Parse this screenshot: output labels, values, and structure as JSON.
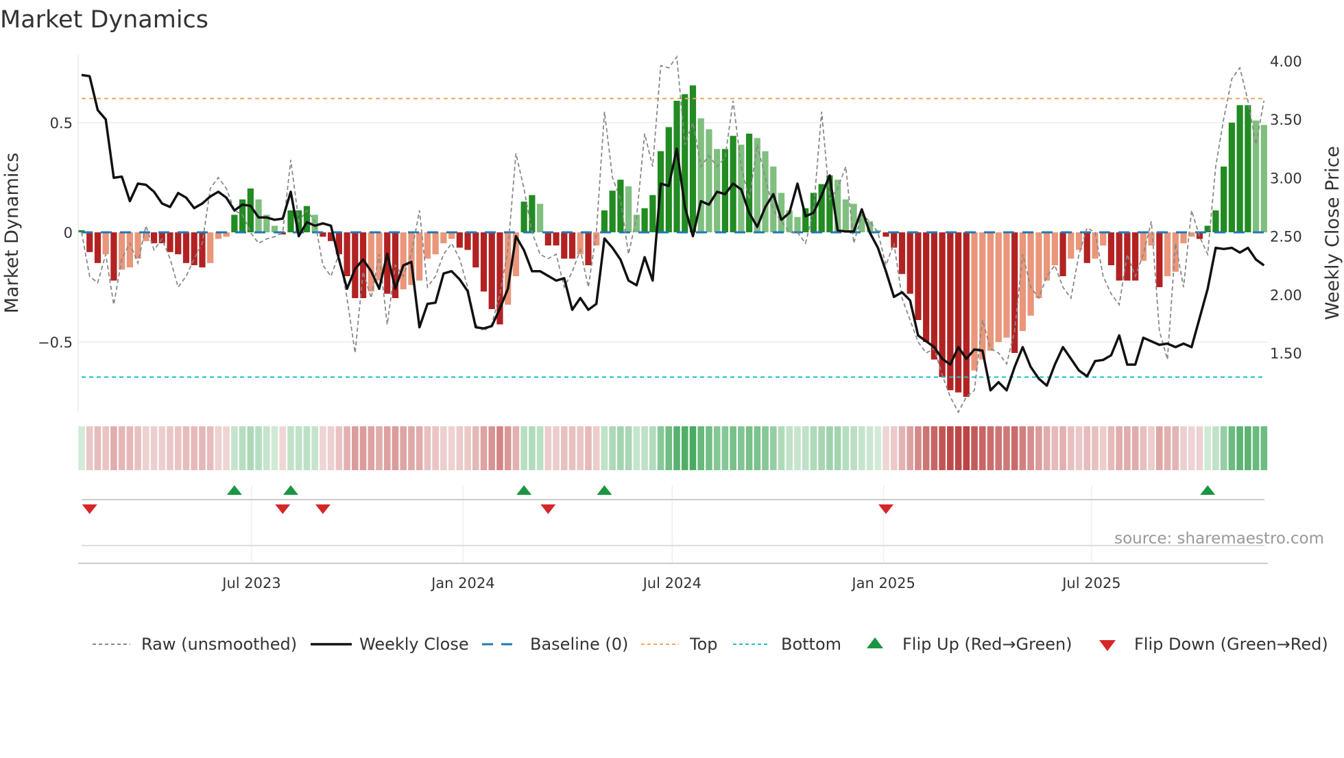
{
  "chart_data": {
    "type": "bar",
    "title": "Market Dynamics",
    "ylabel_left": "Market Dynamics",
    "ylabel_right": "Weekly Close Price",
    "frequency": "weekly",
    "start_date": "2023-02-03",
    "yticks_left": [
      {
        "value": 0.5,
        "label": "0.5"
      },
      {
        "value": 0,
        "label": "0"
      },
      {
        "value": -0.5,
        "label": "−0.5"
      }
    ],
    "yticks_right": [
      {
        "value": 4.0,
        "label": "4.00"
      },
      {
        "value": 3.5,
        "label": "3.50"
      },
      {
        "value": 3.0,
        "label": "3.00"
      },
      {
        "value": 2.5,
        "label": "2.50"
      },
      {
        "value": 2.0,
        "label": "2.00"
      },
      {
        "value": 1.5,
        "label": "1.50"
      }
    ],
    "xticks": [
      {
        "date": "2023-07-01",
        "label": "Jul 2023"
      },
      {
        "date": "2024-01-01",
        "label": "Jan 2024"
      },
      {
        "date": "2024-07-01",
        "label": "Jul 2024"
      },
      {
        "date": "2025-01-01",
        "label": "Jan 2025"
      },
      {
        "date": "2025-07-01",
        "label": "Jul 2025"
      }
    ],
    "ylim_left": [
      -0.82,
      0.81
    ],
    "ylim_right": [
      1.1,
      4.05
    ],
    "top_threshold": 0.61,
    "bottom_threshold": -0.66,
    "baseline": 0,
    "colors": {
      "up_strong": "#228B22",
      "up_weak": "#7fbf7f",
      "down_strong": "#b22222",
      "down_weak": "#e9967a",
      "top": "#f4a460",
      "bottom": "#17becf",
      "baseline": "#1f77b4",
      "flip_up": "#1a9641",
      "flip_down": "#d62728",
      "close": "#111111",
      "raw": "#888888"
    },
    "values": [
      0.01,
      -0.09,
      -0.14,
      -0.1,
      -0.22,
      -0.17,
      -0.16,
      -0.12,
      -0.04,
      -0.05,
      -0.05,
      -0.09,
      -0.1,
      -0.14,
      -0.15,
      -0.16,
      -0.14,
      -0.03,
      -0.02,
      0.08,
      0.15,
      0.2,
      0.15,
      0.08,
      0.03,
      -0.01,
      0.1,
      0.1,
      0.12,
      0.08,
      -0.02,
      -0.04,
      -0.1,
      -0.2,
      -0.3,
      -0.3,
      -0.27,
      -0.22,
      -0.28,
      -0.3,
      -0.26,
      -0.24,
      -0.22,
      -0.12,
      -0.1,
      -0.05,
      -0.03,
      -0.07,
      -0.08,
      -0.16,
      -0.27,
      -0.35,
      -0.42,
      -0.33,
      -0.2,
      0.14,
      0.17,
      0.13,
      -0.06,
      -0.06,
      -0.12,
      -0.12,
      -0.1,
      -0.15,
      -0.06,
      0.1,
      0.19,
      0.24,
      0.21,
      0.08,
      0.11,
      0.17,
      0.37,
      0.48,
      0.6,
      0.63,
      0.67,
      0.52,
      0.47,
      0.38,
      0.38,
      0.44,
      0.4,
      0.45,
      0.43,
      0.37,
      0.3,
      0.18,
      0.1,
      0.07,
      0.11,
      0.18,
      0.22,
      0.26,
      0.24,
      0.15,
      0.13,
      0.08,
      0.05,
      0.01,
      -0.02,
      -0.07,
      -0.19,
      -0.28,
      -0.4,
      -0.5,
      -0.58,
      -0.66,
      -0.72,
      -0.73,
      -0.75,
      -0.63,
      -0.58,
      -0.54,
      -0.5,
      -0.48,
      -0.55,
      -0.45,
      -0.38,
      -0.3,
      -0.22,
      -0.15,
      -0.2,
      -0.12,
      -0.08,
      -0.14,
      -0.12,
      -0.06,
      -0.15,
      -0.22,
      -0.22,
      -0.22,
      -0.13,
      -0.06,
      -0.25,
      -0.2,
      -0.18,
      -0.05,
      -0.02,
      -0.03,
      0.03,
      0.1,
      0.3,
      0.5,
      0.58,
      0.58,
      0.51,
      0.49
    ],
    "raw": [
      0.0,
      -0.2,
      -0.23,
      -0.1,
      -0.33,
      -0.12,
      -0.05,
      -0.14,
      0.03,
      -0.08,
      -0.03,
      -0.12,
      -0.25,
      -0.2,
      -0.12,
      -0.05,
      0.2,
      0.25,
      0.2,
      0.1,
      0.08,
      0.0,
      -0.05,
      -0.03,
      -0.02,
      0.0,
      0.33,
      0.05,
      0.1,
      0.05,
      -0.15,
      -0.2,
      -0.1,
      -0.3,
      -0.55,
      -0.18,
      -0.3,
      -0.1,
      -0.42,
      -0.15,
      -0.2,
      -0.1,
      0.1,
      -0.25,
      -0.2,
      -0.1,
      -0.05,
      -0.12,
      -0.25,
      -0.42,
      -0.45,
      -0.42,
      -0.28,
      -0.08,
      0.36,
      0.2,
      0.0,
      -0.1,
      -0.12,
      -0.1,
      -0.25,
      -0.18,
      -0.08,
      -0.25,
      0.0,
      0.55,
      0.25,
      0.15,
      -0.1,
      0.07,
      0.45,
      0.3,
      0.76,
      0.75,
      0.8,
      0.4,
      0.5,
      0.3,
      0.35,
      0.3,
      0.34,
      0.6,
      0.3,
      0.15,
      0.4,
      0.25,
      0.1,
      0.05,
      0.0,
      0.0,
      -0.05,
      0.1,
      0.55,
      0.15,
      0.2,
      0.3,
      -0.05,
      0.08,
      0.05,
      0.0,
      -0.15,
      -0.05,
      -0.3,
      -0.4,
      -0.5,
      -0.55,
      -0.53,
      -0.65,
      -0.75,
      -0.82,
      -0.75,
      -0.72,
      -0.4,
      -0.53,
      -0.55,
      -0.6,
      -0.45,
      -0.1,
      -0.25,
      -0.3,
      -0.2,
      -0.15,
      -0.25,
      -0.3,
      -0.1,
      0.02,
      0.0,
      -0.2,
      -0.28,
      -0.33,
      -0.1,
      -0.2,
      -0.1,
      0.05,
      -0.45,
      -0.58,
      -0.05,
      -0.25,
      0.1,
      -0.02,
      -0.1,
      0.3,
      0.52,
      0.7,
      0.75,
      0.6,
      0.4,
      0.6
    ],
    "close": [
      3.88,
      3.87,
      3.58,
      3.5,
      3.0,
      3.01,
      2.8,
      2.95,
      2.94,
      2.88,
      2.78,
      2.75,
      2.87,
      2.83,
      2.74,
      2.78,
      2.84,
      2.88,
      2.83,
      2.72,
      2.77,
      2.76,
      2.66,
      2.66,
      2.64,
      2.65,
      2.88,
      2.5,
      2.62,
      2.59,
      2.61,
      2.59,
      2.3,
      2.05,
      2.22,
      2.3,
      2.2,
      2.05,
      2.35,
      2.05,
      2.25,
      2.28,
      1.72,
      1.92,
      1.93,
      2.18,
      2.2,
      2.13,
      2.03,
      1.72,
      1.71,
      1.73,
      1.88,
      2.05,
      2.5,
      2.38,
      2.2,
      2.2,
      2.16,
      2.12,
      2.14,
      1.87,
      1.97,
      1.87,
      1.92,
      2.48,
      2.4,
      2.3,
      2.12,
      2.08,
      2.32,
      2.12,
      2.95,
      2.93,
      3.25,
      2.75,
      2.5,
      2.8,
      2.77,
      2.88,
      2.86,
      2.95,
      2.9,
      2.7,
      2.58,
      2.75,
      2.86,
      2.64,
      2.7,
      2.95,
      2.67,
      2.7,
      2.85,
      3.02,
      2.55,
      2.54,
      2.54,
      2.73,
      2.53,
      2.4,
      2.2,
      1.98,
      2.02,
      1.95,
      1.65,
      1.6,
      1.55,
      1.45,
      1.4,
      1.55,
      1.45,
      1.53,
      1.52,
      1.18,
      1.25,
      1.18,
      1.38,
      1.55,
      1.38,
      1.28,
      1.22,
      1.4,
      1.55,
      1.45,
      1.35,
      1.3,
      1.43,
      1.44,
      1.48,
      1.65,
      1.4,
      1.4,
      1.63,
      1.6,
      1.57,
      1.58,
      1.55,
      1.58,
      1.55,
      1.8,
      2.05,
      2.4,
      2.39,
      2.4,
      2.36,
      2.4,
      2.3,
      2.25
    ],
    "legend": {
      "placement": "bottom",
      "raw": "Raw (unsmoothed)",
      "close": "Weekly Close",
      "baseline": "Baseline (0)",
      "top": "Top",
      "bottom": "Bottom",
      "flip_up": "Flip Up (Red→Green)",
      "flip_down": "Flip Down (Green→Red)"
    },
    "source": "source: sharemaestro.com"
  }
}
